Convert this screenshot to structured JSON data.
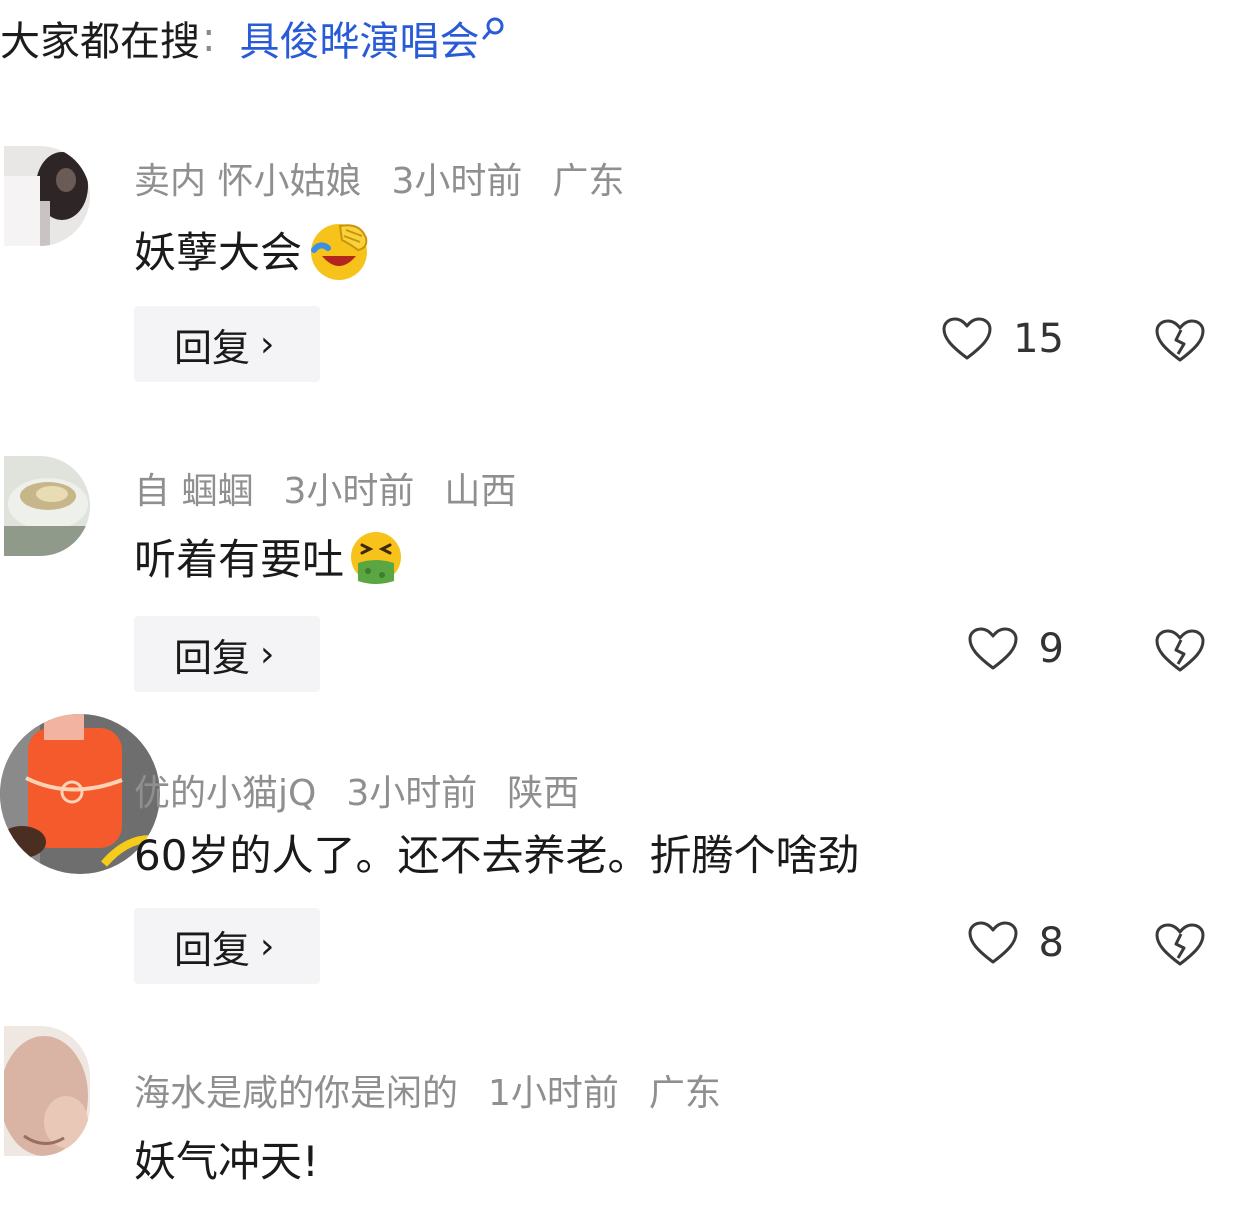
{
  "search": {
    "prefix": "大家都在搜",
    "separator": ":",
    "term": "具俊晔演唱会",
    "term_color": "#2a5bd7"
  },
  "comments": [
    {
      "username": "卖内     怀小姑娘",
      "time": "3小时前",
      "location": "广东",
      "text": "妖孽大会",
      "emoji": "face-palm-laughing-emoji",
      "reply_label": "回复",
      "likes": "15"
    },
    {
      "username": "自       蝈蝈",
      "time": "3小时前",
      "location": "山西",
      "text": "听着有要吐",
      "emoji": "vomiting-face-emoji",
      "reply_label": "回复",
      "likes": "9"
    },
    {
      "username": "  优的小猫jQ",
      "time": "3小时前",
      "location": "陕西",
      "text": "60岁的人了。还不去养老。折腾个啥劲",
      "reply_label": "回复",
      "likes": "8"
    },
    {
      "username": "海水是咸的你是闲的",
      "time": "1小时前",
      "location": "广东",
      "text": "妖气冲天!"
    }
  ],
  "colors": {
    "meta_text": "#8f8f8f",
    "reply_bg": "#f4f4f6",
    "icon_stroke": "#3a3a3a"
  }
}
